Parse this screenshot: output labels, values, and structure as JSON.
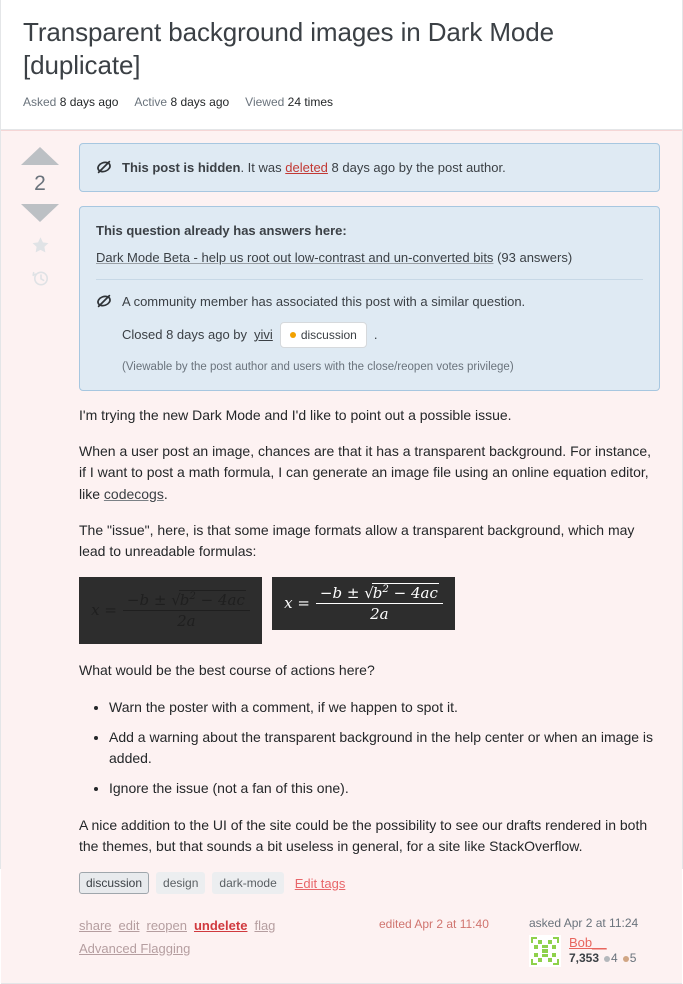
{
  "header": {
    "title": "Transparent background images in Dark Mode [duplicate]",
    "stats": [
      {
        "label": "Asked",
        "value": "8 days ago"
      },
      {
        "label": "Active",
        "value": "8 days ago"
      },
      {
        "label": "Viewed",
        "value": "24 times"
      }
    ]
  },
  "vote": {
    "count": "2",
    "up_icon": "arrow-up-icon",
    "down_icon": "arrow-down-icon",
    "favorite_icon": "star-icon",
    "history_icon": "clock-history-icon"
  },
  "notices": {
    "hidden": {
      "icon": "hidden-eye-off-icon",
      "bold": "This post is hidden",
      "text_before_link": ". It was ",
      "link": "deleted",
      "text_after_link": " 8 days ago by the post author."
    },
    "duplicate": {
      "heading": "This question already has answers here",
      "heading_colon": ":",
      "link": "Dark Mode Beta - help us root out low-contrast and un-converted bits",
      "answer_count": "(93 answers)",
      "icon": "hidden-eye-off-icon",
      "associated_text": "A community member has associated this post with a similar question.",
      "closed_prefix": "Closed 8 days ago by",
      "closed_user": "yivi",
      "closed_tag": "discussion",
      "closed_period": ".",
      "privilege_note": "(Viewable by the post author and users with the close/reopen votes privilege)"
    }
  },
  "body": {
    "p1": "I'm trying the new Dark Mode and I'd like to point out a possible issue.",
    "p2_a": "When a user post an image, chances are that it has a transparent background. For instance, if I want to post a math formula, I can generate an image file using an online equation editor, like ",
    "p2_link": "codecogs",
    "p2_b": ".",
    "p3": "The \"issue\", here, is that some image formats allow a transparent background, which may lead to unreadable formulas:",
    "formula_alt_dark": "quadratic formula, dark text on dark background (unreadable)",
    "formula_alt_light": "quadratic formula, white text on dark background",
    "p4": "What would be the best course of actions here?",
    "list": [
      "Warn the poster with a comment, if we happen to spot it.",
      "Add a warning about the transparent background in the help center or when an image is added.",
      "Ignore the issue (not a fan of this one)."
    ],
    "p5": "A nice addition to the UI of the site could be the possibility to see our drafts rendered in both the themes, but that sounds a bit useless in general, for a site like StackOverflow."
  },
  "tags": {
    "items": [
      {
        "label": "discussion",
        "selected": true
      },
      {
        "label": "design",
        "selected": false
      },
      {
        "label": "dark-mode",
        "selected": false
      }
    ],
    "edit_label": "Edit tags"
  },
  "footer": {
    "actions": [
      "share",
      "edit",
      "reopen",
      "undelete",
      "flag"
    ],
    "advanced_flagging": "Advanced Flagging",
    "edited_stamp": "edited Apr 2 at 11:40",
    "owner": {
      "when": "asked Apr 2 at 11:24",
      "name": "Bob__",
      "reputation": "7,353",
      "silver_badges": "4",
      "bronze_badges": "5",
      "avatar_icon": "identicon-avatar"
    }
  },
  "colors": {
    "deleted_bg": "#fdf2f2",
    "notice_bg": "#dfeaf3",
    "notice_border": "#a7c7e0",
    "accent_red": "#d0393e",
    "formula_bg": "#2d2d2d",
    "gold_dot": "#f2a100"
  }
}
